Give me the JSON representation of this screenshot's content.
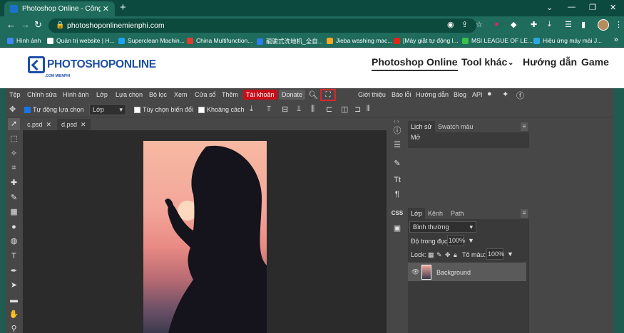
{
  "browser": {
    "tab_title": "Photoshop Online - Công cụ chỉ",
    "tab_close": "✕",
    "new_tab": "+",
    "url": "photoshoponlinemienphi.com",
    "bookmarks": [
      {
        "label": "Hình ảnh",
        "color": "#4285f4"
      },
      {
        "label": "Quản trị website | H...",
        "color": "#ffffff"
      },
      {
        "label": "Superclean Machin...",
        "color": "#1da1f2"
      },
      {
        "label": "China Multifunction...",
        "color": "#e03b2b"
      },
      {
        "label": "龍骏式洗地机_全自...",
        "color": "#2b7de9"
      },
      {
        "label": "Jieba washing mac...",
        "color": "#f5a623"
      },
      {
        "label": "[Máy giặt tự động l...",
        "color": "#e0261b"
      },
      {
        "label": "MSI LEAGUE OF LE...",
        "color": "#36c24a"
      },
      {
        "label": "Hiệu ứng máy mài J...",
        "color": "#2aa7e0"
      }
    ],
    "bookmarks_more": "»"
  },
  "site": {
    "logo_text": "PHOTOSHOPONLINE",
    "logo_sub": ".COM MIENPHI",
    "nav": [
      "Photoshop Online",
      "Tool khác",
      "Hướng dẫn",
      "Game"
    ],
    "nav_dropdown_icon": "chevron-down-icon"
  },
  "app": {
    "menu": [
      "Tệp",
      "Chỉnh sửa",
      "Hình ảnh",
      "Lớp",
      "Lựa chọn",
      "Bộ lọc",
      "Xem",
      "Cửa sổ",
      "Thêm"
    ],
    "account_button": "Tài khoản",
    "donate_button": "Donate",
    "right_menu": [
      "Giới thiệu",
      "Báo lỗi",
      "Hướng dẫn",
      "Blog",
      "API"
    ],
    "options": {
      "auto_select_label": "Tự động lựa chọn",
      "auto_select_checked": true,
      "layer_select": "Lớp",
      "transform_label": "Tùy chọn biến đổi",
      "spacing_label": "Khoảng cách"
    },
    "doc_tabs": [
      {
        "name": "c.psd",
        "close": "✕"
      },
      {
        "name": "d.psd",
        "close": "✕"
      }
    ],
    "history_panel": {
      "tabs": [
        "Lịch sử",
        "Swatch màu"
      ],
      "items": [
        "Mở"
      ]
    },
    "layers_panel": {
      "tabs": [
        "Lớp",
        "Kênh",
        "Path"
      ],
      "blend_mode": "Bình thường",
      "opacity_label": "Độ trong đục:",
      "opacity_value": "100%",
      "lock_label": "Lock:",
      "fill_label": "Tô màu:",
      "fill_value": "100%",
      "layers": [
        {
          "name": "Background",
          "visible": true
        }
      ]
    },
    "colors": {
      "account": "#c80f1a",
      "highlight_box": "#d9262e",
      "checkbox_on": "#1a73e8"
    }
  }
}
